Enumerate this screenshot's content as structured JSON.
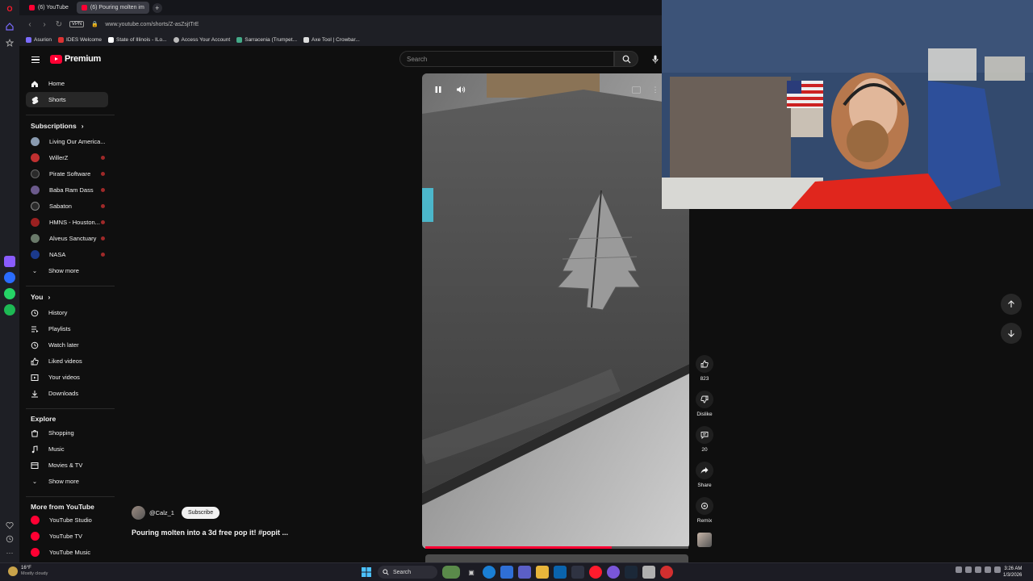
{
  "browser": {
    "tabs": [
      {
        "label": "(6) YouTube"
      },
      {
        "label": "(6) Pouring molten im"
      }
    ],
    "new_tab": "+",
    "vpn_label": "VPN",
    "url": "www.youtube.com/shorts/Z-asZsjtTrE",
    "bookmarks": [
      {
        "label": "Asurion"
      },
      {
        "label": "IDES Welcome"
      },
      {
        "label": "State of Illinois - ILo..."
      },
      {
        "label": "Access Your Account"
      },
      {
        "label": "Sarracenia (Trumpet..."
      },
      {
        "label": "Axe Tool | Crowbar..."
      }
    ]
  },
  "header": {
    "logo_text": "Premium",
    "search_placeholder": "Search"
  },
  "sidebar": {
    "main": [
      {
        "label": "Home",
        "icon": "home-icon"
      },
      {
        "label": "Shorts",
        "icon": "shorts-icon",
        "active": true
      }
    ],
    "subscriptions_heading": "Subscriptions",
    "subscriptions": [
      {
        "label": "Living Our America...",
        "color": "#8a9bb0"
      },
      {
        "label": "WillerZ",
        "color": "#c03030"
      },
      {
        "label": "Pirate Software",
        "color": "#2a2a2a"
      },
      {
        "label": "Baba Ram Dass",
        "color": "#6b5a8c"
      },
      {
        "label": "Sabaton",
        "color": "#2a2a2a"
      },
      {
        "label": "HMNS - Houston...",
        "color": "#9a2020"
      },
      {
        "label": "Alveus Sanctuary",
        "color": "#6a7a6a"
      },
      {
        "label": "NASA",
        "color": "#1b3a8c"
      }
    ],
    "show_more_1": "Show more",
    "you_heading": "You",
    "you_items": [
      {
        "label": "History",
        "icon": "history-icon"
      },
      {
        "label": "Playlists",
        "icon": "playlists-icon"
      },
      {
        "label": "Watch later",
        "icon": "watch-later-icon"
      },
      {
        "label": "Liked videos",
        "icon": "like-icon"
      },
      {
        "label": "Your videos",
        "icon": "your-videos-icon"
      },
      {
        "label": "Downloads",
        "icon": "download-icon"
      }
    ],
    "explore_heading": "Explore",
    "explore_items": [
      {
        "label": "Shopping",
        "icon": "shopping-icon"
      },
      {
        "label": "Music",
        "icon": "music-icon"
      },
      {
        "label": "Movies & TV",
        "icon": "movies-icon"
      }
    ],
    "show_more_2": "Show more",
    "more_heading": "More from YouTube",
    "more_items": [
      {
        "label": "YouTube Studio"
      },
      {
        "label": "YouTube TV"
      },
      {
        "label": "YouTube Music"
      }
    ]
  },
  "short": {
    "channel": "@Calz_1",
    "subscribe_label": "Subscribe",
    "title": "Pouring molten into a 3d free pop it! #popit ...",
    "progress": 0.71
  },
  "actions": {
    "likes": "823",
    "dislike": "Dislike",
    "comments": "20",
    "share": "Share",
    "remix": "Remix"
  },
  "taskbar": {
    "weather_temp": "16°F",
    "weather_cond": "Mostly cloudy",
    "search_label": "Search",
    "time": "3:26 AM",
    "date": "1/3/2026"
  },
  "colors": {
    "accent": "#ff0033",
    "background": "#0f0f0f"
  }
}
